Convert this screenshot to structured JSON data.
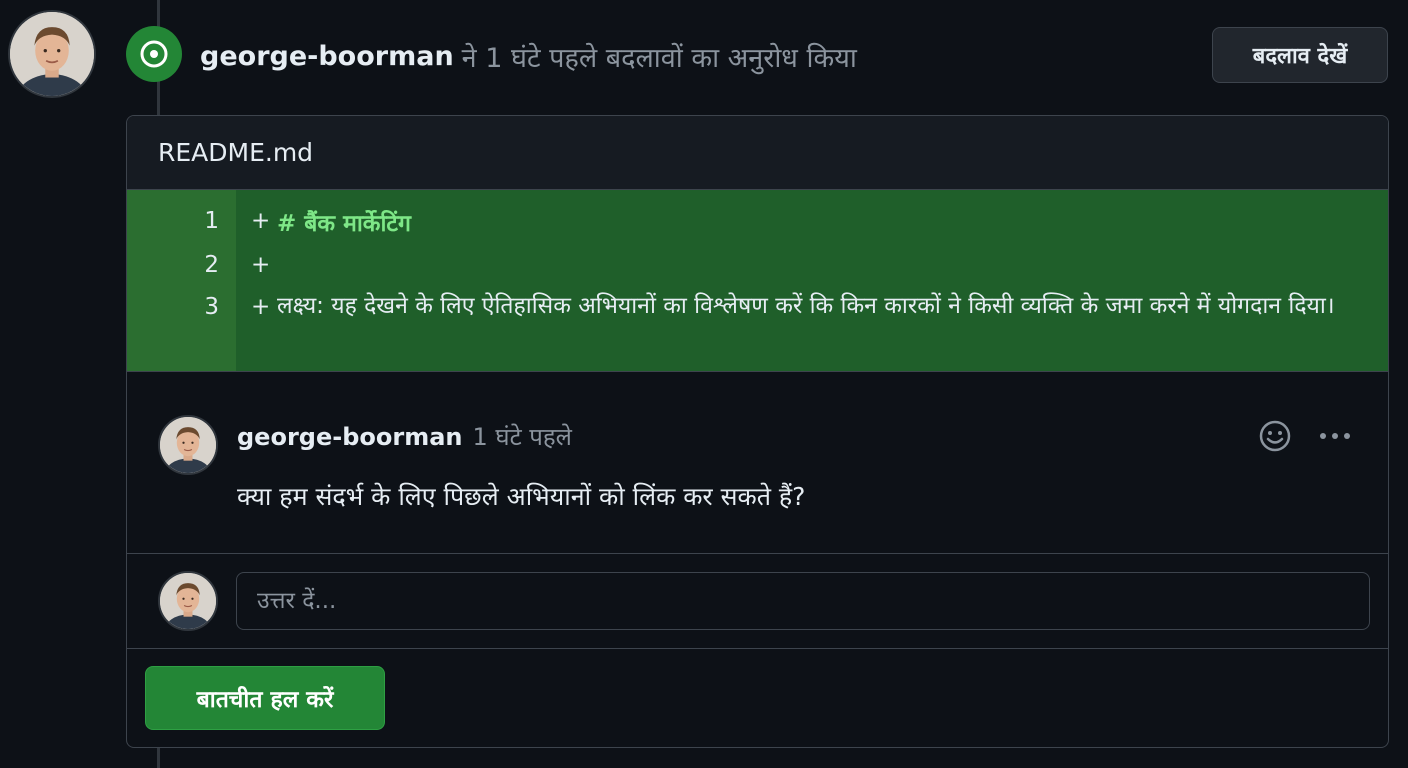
{
  "header": {
    "user": "george-boorman",
    "action": "ने 1 घंटे पहले बदलावों का अनुरोध किया",
    "view_changes_label": "बदलाव देखें"
  },
  "file": {
    "name": "README.md"
  },
  "diff": {
    "lines": [
      {
        "num": "1",
        "sign": "+",
        "code": "# बैंक मार्केटिंग"
      },
      {
        "num": "2",
        "sign": "+",
        "code": ""
      },
      {
        "num": "3",
        "sign": "+",
        "code": "लक्ष्य: यह देखने के लिए ऐतिहासिक अभियानों का विश्लेषण करें कि किन कारकों ने किसी व्यक्ति के जमा करने में योगदान दिया।"
      }
    ]
  },
  "comment": {
    "author": "george-boorman",
    "time": "1 घंटे पहले",
    "body": "क्या हम संदर्भ के लिए पिछले अभियानों को लिंक कर सकते हैं?"
  },
  "reply": {
    "placeholder": "उत्तर दें..."
  },
  "actions": {
    "resolve_label": "बातचीत हल करें"
  },
  "colors": {
    "accent_green": "#238636",
    "diff_added_bg": "#1f5f2a",
    "heading_green": "#7ee787"
  },
  "icons": {
    "status": "dot-circle-icon",
    "reaction": "smiley-icon",
    "more": "kebab-horizontal-icon"
  }
}
